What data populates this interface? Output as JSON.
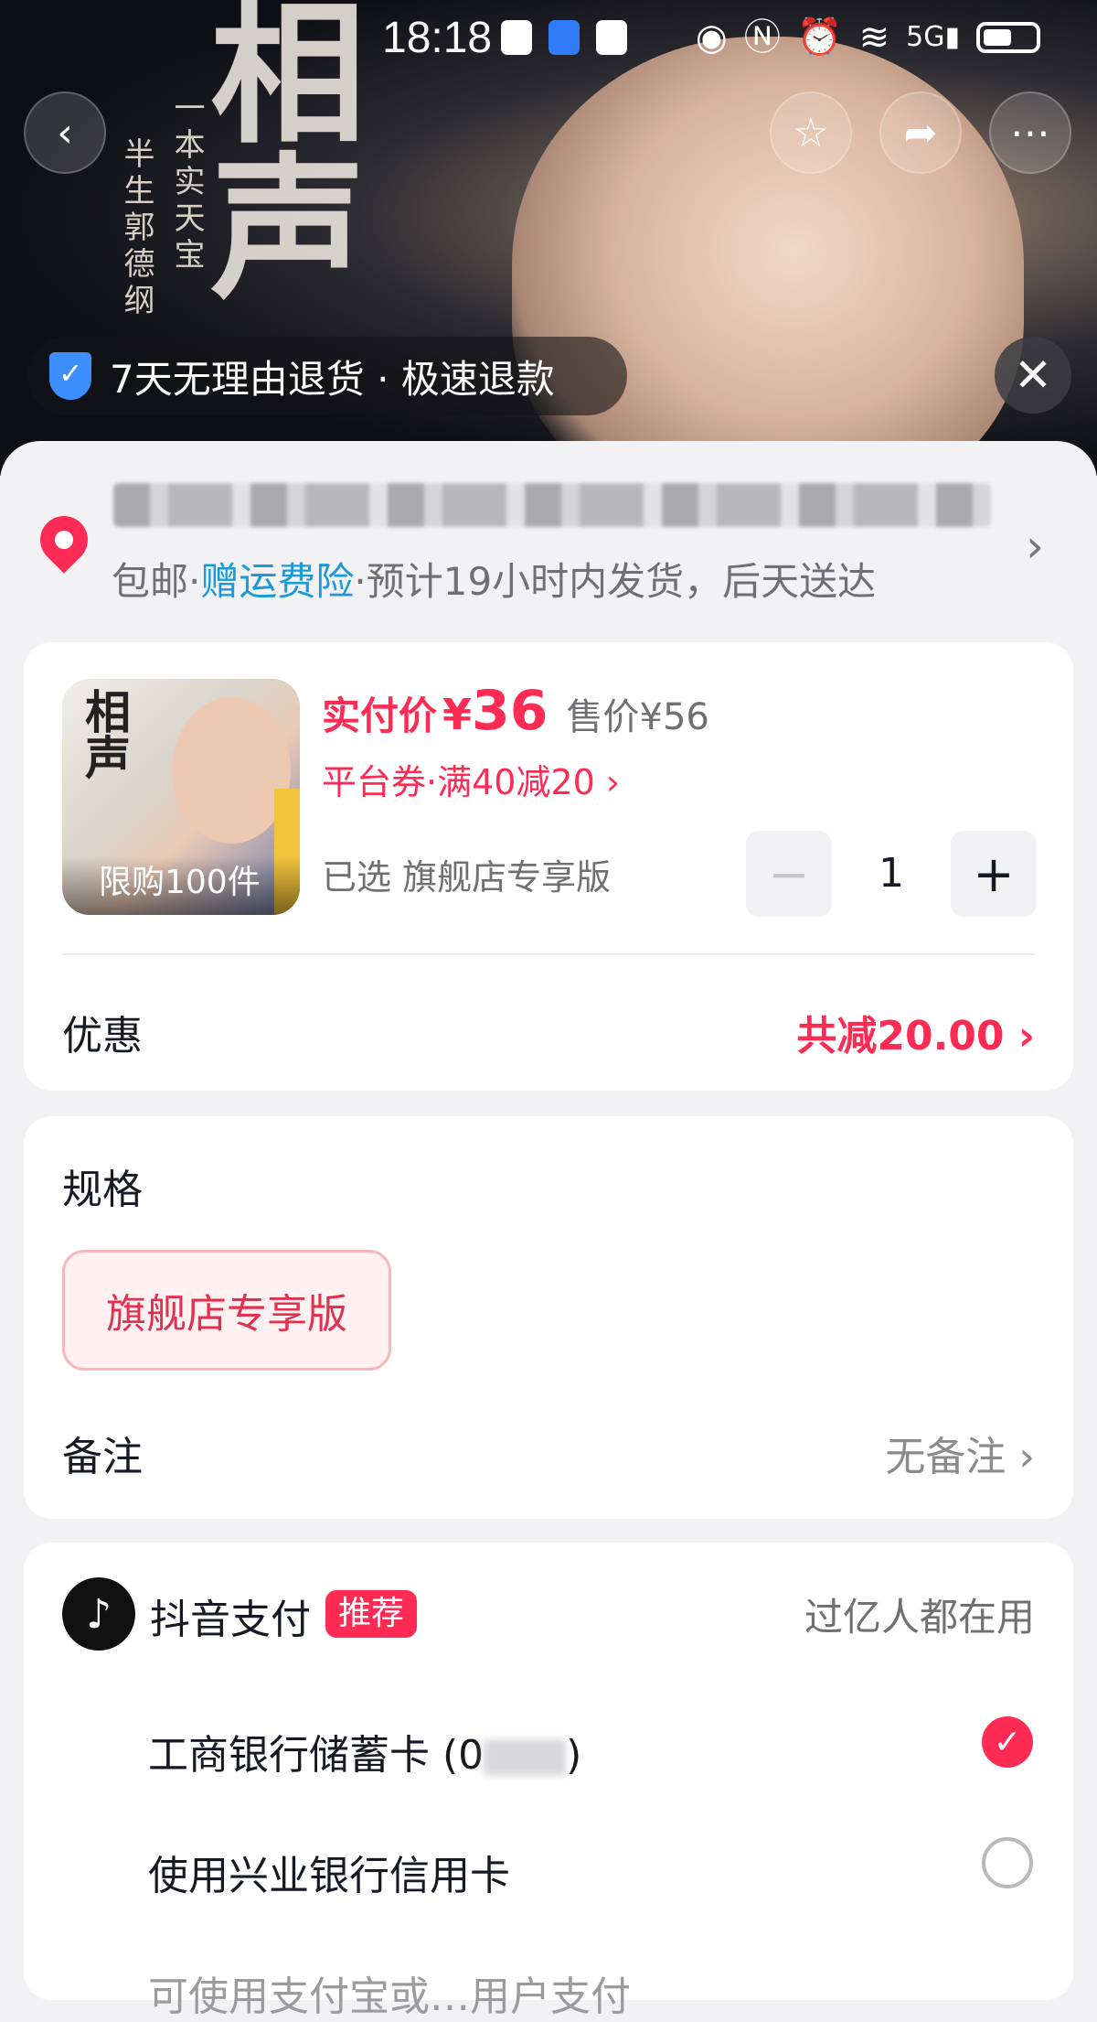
{
  "status_bar": {
    "time": "18:18",
    "icons": [
      "huawei-app-icon",
      "alipay-app-icon",
      "huawei-app-icon",
      "eye-icon",
      "nfc-icon",
      "alarm-icon",
      "wifi-icon",
      "5g-signal-icon",
      "battery-icon"
    ]
  },
  "hero": {
    "cover_calligraphy": "相声",
    "cover_small_text_1": "一本实天宝",
    "cover_small_text_2": "半生郭德纲",
    "return_policy": "7天无理由退货 · 极速退款"
  },
  "address": {
    "shipping_prefix": "包邮·",
    "shipping_insurance": "赠运费险",
    "shipping_suffix": "·预计19小时内发货，后天送达"
  },
  "product": {
    "thumb_title": "相声",
    "limit_label": "限购100件",
    "actual_price_label": "实付价",
    "currency": "¥",
    "actual_price": "36",
    "original_price": "售价¥56",
    "coupon": "平台券·满40减20 ›",
    "selected_prefix": "已选",
    "selected_variant": "旗舰店专享版",
    "quantity": "1",
    "minus": "−",
    "plus": "+"
  },
  "discount": {
    "label": "优惠",
    "value": "共减20.00 ›"
  },
  "spec": {
    "title": "规格",
    "option": "旗舰店专享版"
  },
  "remark": {
    "label": "备注",
    "value": "无备注 ›"
  },
  "payment": {
    "title": "抖音支付",
    "badge": "推荐",
    "slogan": "过亿人都在用",
    "options": [
      {
        "label": "工商银行储蓄卡 (0",
        "suffix": ")",
        "selected": true
      },
      {
        "label": "使用兴业银行信用卡",
        "selected": false
      },
      {
        "label": "可使用支付宝或…用户支付",
        "selected": false
      }
    ]
  },
  "colors": {
    "accent": "#fe2c55",
    "link_blue": "#1a9ad8",
    "text_primary": "#161823",
    "text_secondary": "#6f7076",
    "page_bg": "#f2f2f4"
  }
}
